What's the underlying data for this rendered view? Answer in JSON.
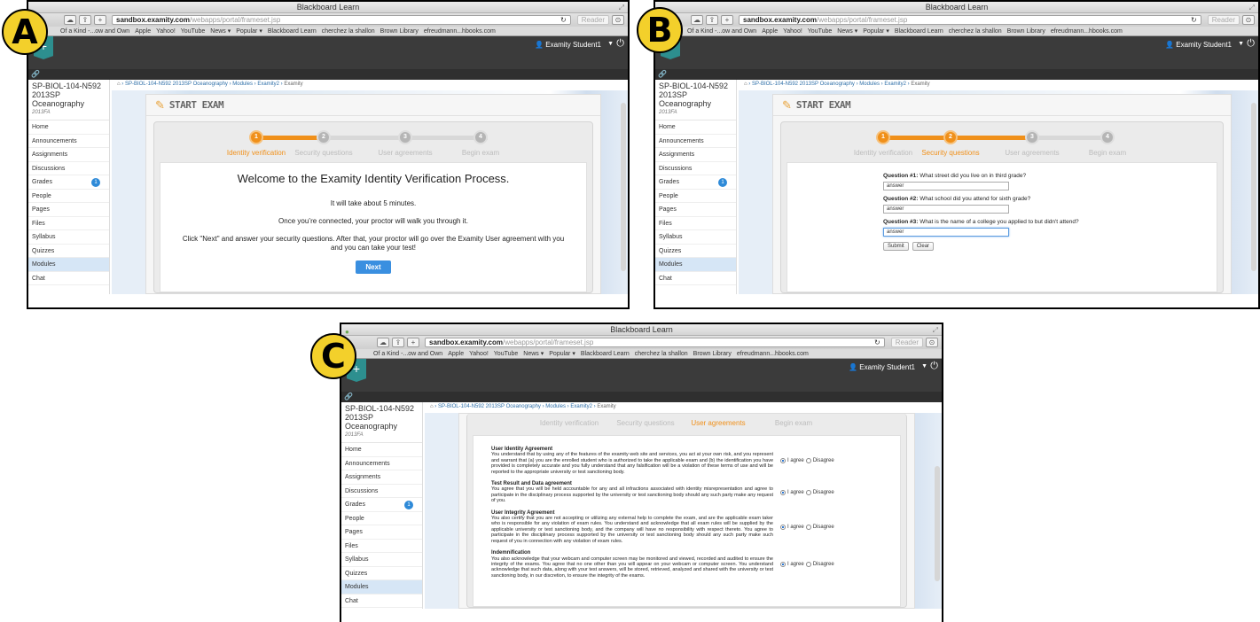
{
  "panel_labels": [
    "A",
    "B",
    "C"
  ],
  "browser": {
    "window_title": "Blackboard Learn",
    "url_host": "sandbox.examity.com",
    "url_path": "/webapps/portal/frameset.jsp",
    "reader_label": "Reader",
    "bookmarks": [
      "Of a Kind -...ow and Own",
      "Apple",
      "Yahoo!",
      "YouTube",
      "News ▾",
      "Popular ▾",
      "Blackboard Learn",
      "cherchez la shallon",
      "Brown Library",
      "efreudmann...hbooks.com"
    ]
  },
  "topnav": {
    "user_name": "Examity Student1"
  },
  "sidebar": {
    "course_title": "SP-BIOL-104-N592 2013SP Oceanography",
    "course_term": "2013FA",
    "items": [
      {
        "label": "Home"
      },
      {
        "label": "Announcements"
      },
      {
        "label": "Assignments"
      },
      {
        "label": "Discussions"
      },
      {
        "label": "Grades",
        "badge": "1"
      },
      {
        "label": "People"
      },
      {
        "label": "Pages"
      },
      {
        "label": "Files"
      },
      {
        "label": "Syllabus"
      },
      {
        "label": "Quizzes"
      },
      {
        "label": "Modules",
        "active": true
      },
      {
        "label": "Chat"
      }
    ]
  },
  "breadcrumb": {
    "course": "SP-BIOL-104-N592 2013SP Oceanography",
    "modules": "Modules",
    "module": "Examity2",
    "current": "Examity"
  },
  "exam": {
    "header_title": "START EXAM",
    "steps": [
      {
        "number": "1",
        "label": "Identity verification"
      },
      {
        "number": "2",
        "label": "Security questions"
      },
      {
        "number": "3",
        "label": "User agreements"
      },
      {
        "number": "4",
        "label": "Begin exam"
      }
    ]
  },
  "panel_a": {
    "heading": "Welcome to the Examity Identity Verification Process.",
    "line1": "It will take about 5 minutes.",
    "line2": "Once you’re connected, your proctor will walk you through it.",
    "line3": "Click \"Next\" and answer your security questions. After that, your proctor will go over the Examity User agreement with you and you can take your test!",
    "next_label": "Next"
  },
  "panel_b": {
    "questions": [
      {
        "label": "Question #1:",
        "text": "What street did you live on in third grade?",
        "answer": "answer"
      },
      {
        "label": "Question #2:",
        "text": "What school did you attend for sixth grade?",
        "answer": "answer"
      },
      {
        "label": "Question #3:",
        "text": "What is the name of a college you applied to but didn't attend?",
        "answer": "answer"
      }
    ],
    "submit_label": "Submit",
    "clear_label": "Clear"
  },
  "panel_c": {
    "agree_label": "I agree",
    "disagree_label": "Disagree",
    "sections": [
      {
        "title": "User Identity Agreement",
        "body": "You understand that by using any of the features of the examity web site and services, you act at your own risk, and you represent and warrant that (a) you are the enrolled student who is authorized to take the applicable exam and (b) the identification you have provided is completely accurate and you fully understand that any falsification will be a violation of these terms of use and will be reported to the appropriate university or test sanctioning body."
      },
      {
        "title": "Test Result and Data agreement",
        "body": "You agree that you will be held accountable for any and all infractions associated with identity misrepresentation and agree to participate in the disciplinary process supported by the university or test sanctioning body should any such party make any request of you."
      },
      {
        "title": "User Integrity Agreement",
        "body": "You also certify that you are not accepting or utilizing any external help to complete the exam, and are the applicable exam taker who is responsible for any violation of exam rules. You understand and acknowledge that all exam rules will be supplied by the applicable university or test sanctioning body, and the company will have no responsibility with respect thereto. You agree to participate in the disciplinary process supported by the university or test sanctioning body should any such party make such request of you in connection with any violation of exam rules."
      },
      {
        "title": "Indemnification",
        "body": "You also acknowledge that your webcam and computer screen may be monitored and viewed, recorded and audited to ensure the integrity of the exams. You agree that no one other than you will appear on your webcam or computer screen. You understand acknowledge that such data, along with your test answers, will be stored, retrieved, analyzed and shared with the university or test sanctioning body, in our discretion, to ensure the integrity of the exams."
      }
    ]
  },
  "colors": {
    "accent": "#f0901a",
    "link": "#2e6fa8",
    "label_badge": "#f3d02b"
  }
}
